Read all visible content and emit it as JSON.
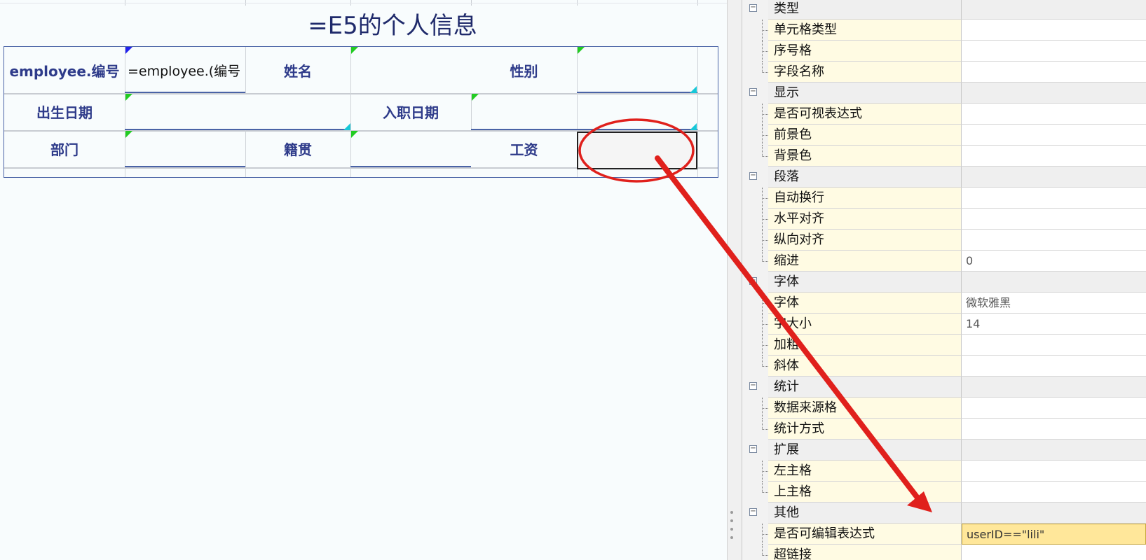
{
  "report": {
    "title": "=E5的个人信息",
    "rows": [
      {
        "label1": "employee.编号",
        "expr1": "=employee.(编号",
        "label2": "姓名",
        "label3": "性别"
      },
      {
        "label1": "出生日期",
        "label2": "入职日期"
      },
      {
        "label1": "部门",
        "label2": "籍贯",
        "label3": "工资"
      }
    ]
  },
  "properties": {
    "rows": [
      {
        "name": "类型",
        "value": "",
        "group": true
      },
      {
        "name": "单元格类型",
        "value": ""
      },
      {
        "name": "序号格",
        "value": ""
      },
      {
        "name": "字段名称",
        "value": ""
      },
      {
        "name": "显示",
        "value": "",
        "group": true
      },
      {
        "name": "是否可视表达式",
        "value": ""
      },
      {
        "name": "前景色",
        "value": ""
      },
      {
        "name": "背景色",
        "value": ""
      },
      {
        "name": "段落",
        "value": "",
        "group": true
      },
      {
        "name": "自动换行",
        "value": ""
      },
      {
        "name": "水平对齐",
        "value": ""
      },
      {
        "name": "纵向对齐",
        "value": ""
      },
      {
        "name": "缩进",
        "value": "0"
      },
      {
        "name": "字体",
        "value": "",
        "group": true
      },
      {
        "name": "字体",
        "value": "微软雅黑"
      },
      {
        "name": "字大小",
        "value": "14"
      },
      {
        "name": "加粗",
        "value": ""
      },
      {
        "name": "斜体",
        "value": ""
      },
      {
        "name": "统计",
        "value": "",
        "group": true
      },
      {
        "name": "数据来源格",
        "value": ""
      },
      {
        "name": "统计方式",
        "value": ""
      },
      {
        "name": "扩展",
        "value": "",
        "group": true
      },
      {
        "name": "左主格",
        "value": ""
      },
      {
        "name": "上主格",
        "value": ""
      },
      {
        "name": "其他",
        "value": "",
        "group": true
      },
      {
        "name": "是否可编辑表达式",
        "value": "userID==\"lili\"",
        "selected": true
      },
      {
        "name": "超链接",
        "value": ""
      }
    ]
  },
  "colors": {
    "annotation": "#e0201c",
    "title": "#1f2a6b",
    "label": "#2e3b8a",
    "selected_value_bg": "#ffe79a",
    "name_bg": "#fffbe3"
  }
}
